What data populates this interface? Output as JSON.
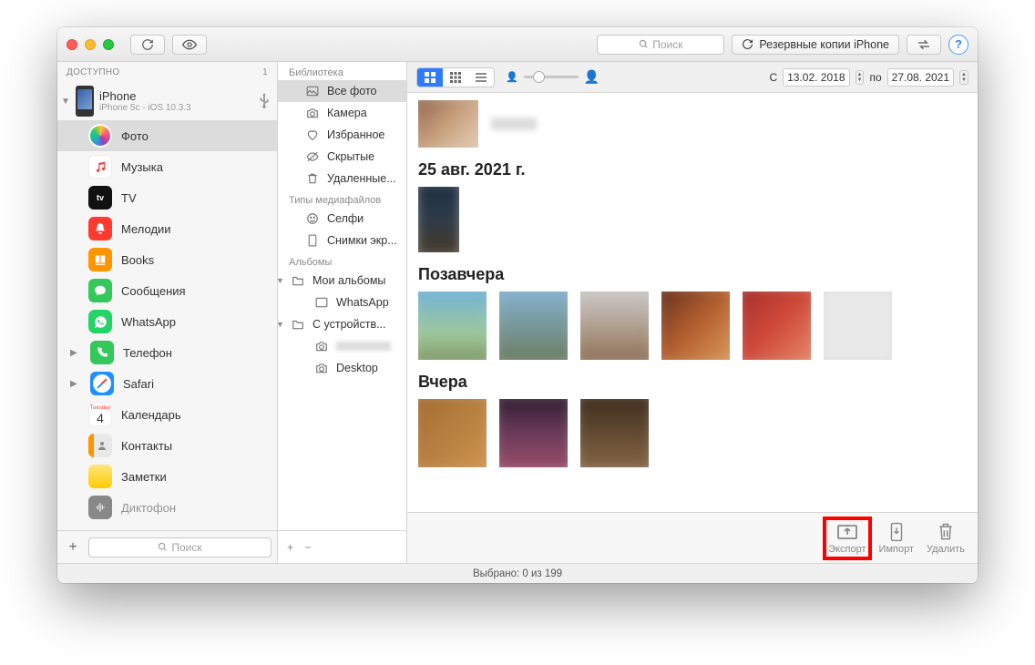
{
  "toolbar": {
    "search_placeholder": "Поиск",
    "backup_label": "Резервные копии iPhone",
    "help_label": "?"
  },
  "sidebar": {
    "section": "ДОСТУПНО",
    "section_count": "1",
    "device": {
      "name": "iPhone",
      "sub": "iPhone 5c - iOS 10.3.3"
    },
    "items": [
      {
        "label": "Фото"
      },
      {
        "label": "Музыка"
      },
      {
        "label": "TV"
      },
      {
        "label": "Мелодии"
      },
      {
        "label": "Books"
      },
      {
        "label": "Сообщения"
      },
      {
        "label": "WhatsApp"
      },
      {
        "label": "Телефон"
      },
      {
        "label": "Safari"
      },
      {
        "label": "Календарь"
      },
      {
        "label": "Контакты"
      },
      {
        "label": "Заметки"
      },
      {
        "label": "Диктофон"
      }
    ],
    "cal_dow": "Tuesday",
    "cal_day": "4",
    "search_placeholder": "Поиск"
  },
  "library": {
    "sec1": "Библиотека",
    "items1": [
      {
        "label": "Все фото"
      },
      {
        "label": "Камера"
      },
      {
        "label": "Избранное"
      },
      {
        "label": "Скрытые"
      },
      {
        "label": "Удаленные..."
      }
    ],
    "sec2": "Типы медиафайлов",
    "items2": [
      {
        "label": "Селфи"
      },
      {
        "label": "Снимки экр..."
      }
    ],
    "sec3": "Альбомы",
    "my_albums": "Мои альбомы",
    "whatsapp": "WhatsApp",
    "from_device": "С устройств...",
    "hidden_album": "",
    "desktop": "Desktop"
  },
  "topbar": {
    "from_label": "С",
    "date_from": "13.02. 2018",
    "to_label": "по",
    "date_to": "27.08. 2021"
  },
  "gallery": {
    "g1": "25 авг. 2021 г.",
    "g2": "Позавчера",
    "g3": "Вчера"
  },
  "bottom": {
    "export": "Экспорт",
    "import": "Импорт",
    "delete": "Удалить"
  },
  "status": "Выбрано: 0 из 199"
}
